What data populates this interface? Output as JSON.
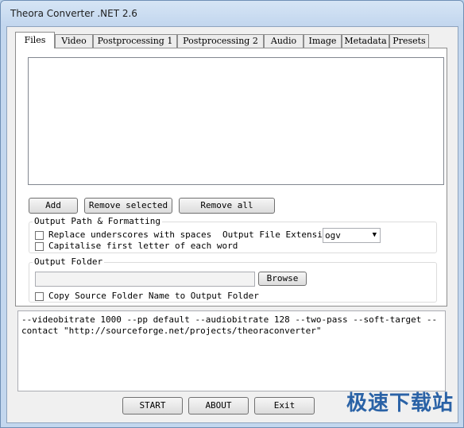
{
  "window": {
    "title": "Theora Converter .NET 2.6"
  },
  "tabs": [
    {
      "label": "Files"
    },
    {
      "label": "Video"
    },
    {
      "label": "Postprocessing 1"
    },
    {
      "label": "Postprocessing 2"
    },
    {
      "label": "Audio"
    },
    {
      "label": "Image"
    },
    {
      "label": "Metadata"
    },
    {
      "label": "Presets"
    }
  ],
  "files": {
    "add_label": "Add",
    "remove_selected_label": "Remove selected",
    "remove_all_label": "Remove all",
    "output_path_group": "Output Path & Formatting",
    "replace_underscores_label": "Replace underscores with spaces",
    "replace_underscores_checked": false,
    "capitalise_label": "Capitalise first letter of each word",
    "capitalise_checked": false,
    "output_extension_label": "Output File Extension",
    "output_extension_value": "ogv",
    "output_folder_group": "Output Folder",
    "output_folder_value": "",
    "browse_label": "Browse",
    "copy_source_folder_label": "Copy Source Folder Name to Output Folder",
    "copy_source_folder_checked": false
  },
  "command_line": "--videobitrate 1000 --pp default --audiobitrate 128 --two-pass --soft-target --contact \"http://sourceforge.net/projects/theoraconverter\"",
  "footer": {
    "start_label": "START",
    "about_label": "ABOUT",
    "exit_label": "Exit"
  },
  "watermark": "极速下载站"
}
